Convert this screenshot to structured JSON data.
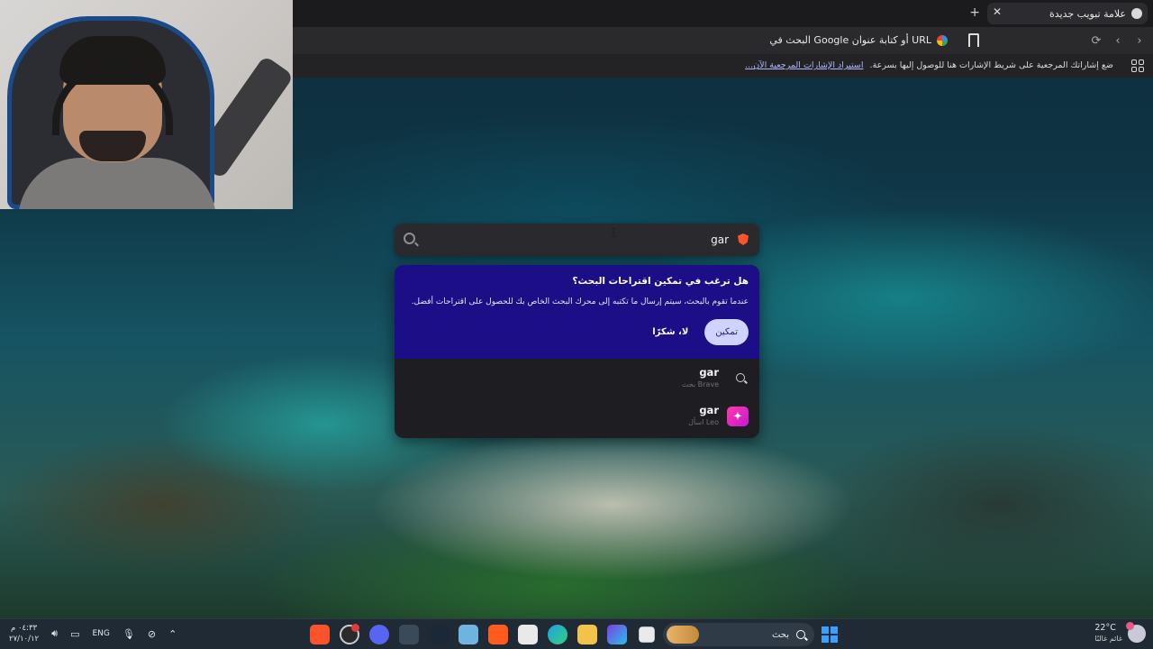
{
  "browser": {
    "tab": {
      "title": "علامة تبويب جديدة"
    },
    "new_tab_symbol": "+",
    "close_symbol": "✕",
    "address_bar": {
      "text": "البحث في Google أو كتابة عنوان URL"
    },
    "nav": {
      "back": "‹",
      "forward": "›",
      "reload": "⟳"
    },
    "bookmarks_bar": {
      "message": "ضع إشاراتك المرجعية على شريط الإشارات هنا للوصول إليها بسرعة.",
      "link": "استيراد الإشارات المرجعية الآن..."
    }
  },
  "search": {
    "query": "gar"
  },
  "promo": {
    "title": "هل ترغب في تمكين اقتراحات البحث؟",
    "description": "عندما تقوم بالبحث، سيتم إرسال ما تكتبه إلى محرك البحث الخاص بك للحصول على اقتراحات أفضل.",
    "enable_label": "تمكين",
    "decline_label": "لا، شكرًا"
  },
  "suggestions": [
    {
      "text": "gar",
      "sub": "بحث Brave",
      "icon": "search-icon"
    },
    {
      "text": "gar",
      "sub": "اسأل Leo",
      "icon": "leo-icon"
    }
  ],
  "taskbar": {
    "time": "٠٤:٣٣ م",
    "date": "٢٧/١٠/١٢",
    "language": "ENG",
    "search_label": "بحث",
    "weather": {
      "temp": "22°C",
      "condition": "غائم غالبًا"
    }
  },
  "colors": {
    "promo_bg": "#1c0e86",
    "enable_btn": "#cfd3ff",
    "brave_orange": "#fb542b",
    "leo_pink": "#ff3aa6"
  }
}
